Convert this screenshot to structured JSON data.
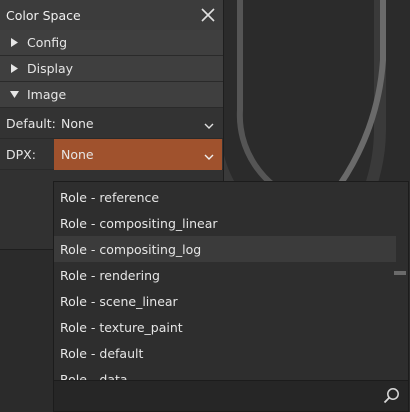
{
  "window": {
    "title": "Color Space"
  },
  "sections": [
    {
      "label": "Config",
      "expanded": false
    },
    {
      "label": "Display",
      "expanded": false
    },
    {
      "label": "Image",
      "expanded": true
    }
  ],
  "rows": [
    {
      "label": "Default:",
      "value": "None"
    },
    {
      "label": "DPX:",
      "value": "None"
    }
  ],
  "dropdown": {
    "items": [
      "Role - reference",
      "Role - compositing_linear",
      "Role - compositing_log",
      "Role - rendering",
      "Role - scene_linear",
      "Role - texture_paint",
      "Role - default",
      "Role - data"
    ],
    "highlighted": "Role - compositing_log",
    "search_value": ""
  },
  "icons": {
    "close": "close-icon",
    "collapsed": "triangle-right-icon",
    "expanded": "triangle-down-icon",
    "combo": "chevron-down-icon",
    "search": "search-icon"
  },
  "colors": {
    "accent": "#a0522d",
    "background": "#2b2b2b",
    "panel": "#313131"
  }
}
